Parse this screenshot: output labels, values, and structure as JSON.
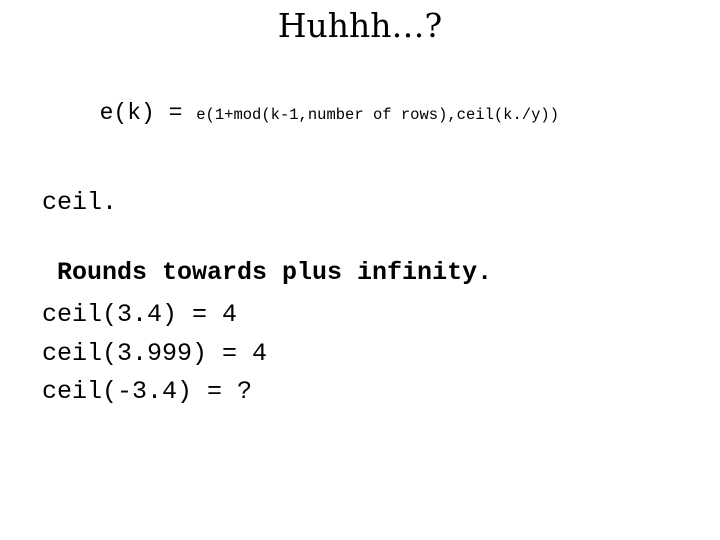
{
  "slide": {
    "title": "Huhhh…?",
    "formula": {
      "lhs": "e(k) = ",
      "rhs": "e(1+mod(k-1,number of rows),ceil(k./y))"
    },
    "function_name": "ceil.",
    "description": " Rounds towards plus infinity.",
    "examples": [
      "ceil(3.4) = 4",
      "ceil(3.999) = 4",
      "ceil(-3.4) = ?"
    ],
    "colors": {
      "background": "#ffffff",
      "text": "#000000"
    }
  }
}
